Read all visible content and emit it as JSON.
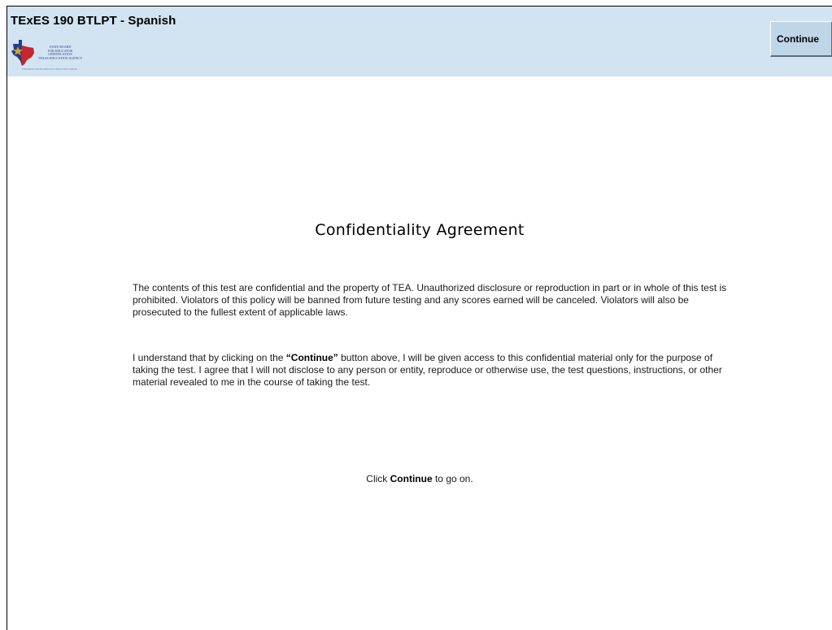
{
  "header": {
    "title": "TExES 190 BTLPT - Spanish",
    "continue_label": "Continue",
    "logo": {
      "lines": [
        "STATE BOARD",
        "FOR EDUCATOR",
        "CERTIFICATION",
        "TEXAS EDUCATION AGENCY"
      ],
      "tagline": "ENSURING EXCELLENCE IN TEXAS EDUCATION",
      "colors": {
        "blue": "#1f3f8f",
        "red": "#c8252c",
        "gold": "#d9a322"
      }
    },
    "background": "#d2e4f1"
  },
  "content": {
    "title": "Confidentiality Agreement",
    "paragraph1": "The contents of this test are confidential and the property of TEA. Unauthorized disclosure or reproduction in part or in whole of this test is prohibited. Violators of this policy will be banned from future testing and any scores earned will be canceled. Violators will also be prosecuted to the fullest extent of applicable laws.",
    "paragraph2": {
      "before": "I understand that by clicking on the ",
      "bold": "“Continue”",
      "after": " button above, I will be given access to this confidential material only for the purpose of taking the test. I agree that I will not disclose to any person or entity, reproduce or otherwise use, the test questions, instructions, or other material revealed to me in the course of taking the test."
    },
    "instruction": {
      "before": "Click ",
      "bold": "Continue",
      "after": " to go on."
    }
  }
}
